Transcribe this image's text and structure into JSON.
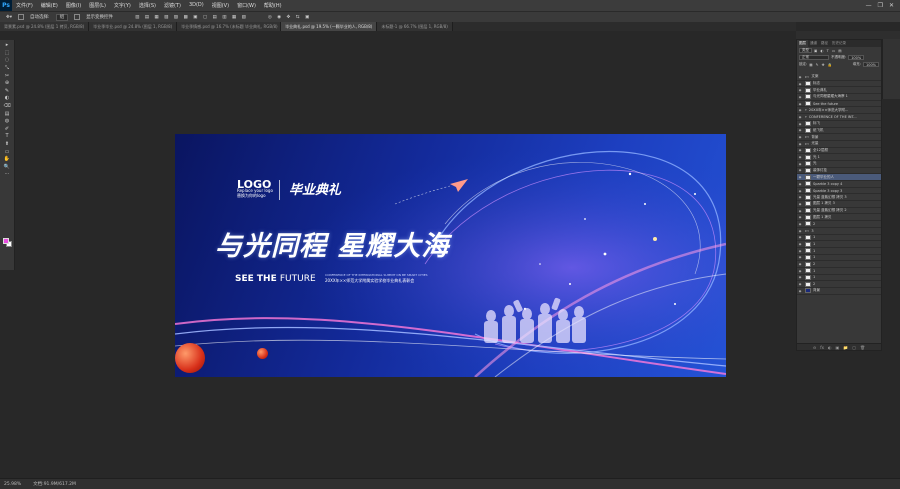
{
  "app": {
    "logo": "Ps"
  },
  "menu": [
    "文件(F)",
    "编辑(E)",
    "图像(I)",
    "图层(L)",
    "文字(Y)",
    "选择(S)",
    "滤镜(T)",
    "3D(D)",
    "视图(V)",
    "窗口(W)",
    "帮助(H)"
  ],
  "window_controls": [
    "—",
    "❐",
    "✕"
  ],
  "options_bar": {
    "auto_select_label": "自动选择:",
    "auto_select_value": "组",
    "show_transform_label": "显示变换控件"
  },
  "tabs": [
    {
      "label": "背景素.psd @ 24.8% (图层 1 拷贝, RGB/8)"
    },
    {
      "label": "毕业季毕业.psd @ 24.8% (图层 1, RGB/8)"
    },
    {
      "label": "毕业季情感.psd @ 16.7% (未标题 毕业典礼, RGB/8)"
    },
    {
      "label": "毕业典礼.psd @ 19.5% (一颗毕业的人, RGB/8)",
      "active": true
    },
    {
      "label": "未标题-1 @ 66.7% (图层 1, RGB/8)"
    }
  ],
  "tools": [
    "▸",
    "⬚",
    "◌",
    "⤡",
    "✂",
    "⊕",
    "✎",
    "◐",
    "⌫",
    "▤",
    "◍",
    "✐",
    "T",
    "⬆",
    "▭",
    "✋",
    "🔍",
    "⋯"
  ],
  "colors": {
    "foreground": "#e94ddf",
    "background": "#ffffff",
    "accent": "#31a8ff"
  },
  "canvas": {
    "logo_text": "LOGO",
    "logo_sub_1": "Replace your logo",
    "logo_sub_2": "替换为你的logo",
    "graduation": "毕业典礼",
    "headline": "与光同程  星耀大海",
    "see_bold": "SEE THE",
    "see_thin": "FUTURE",
    "see_small": "CONFERENCE OF THE INTERNATIONAL SUMMIT ON BE SMART CITIES",
    "see_small_2": "20XX年××师范大学附属实验学校毕业典礼表彰会"
  },
  "panel": {
    "tabs": [
      "图层",
      "通道",
      "路径",
      "历史记录"
    ],
    "blend_mode": "正常",
    "opacity_label": "不透明度:",
    "opacity_value": "100%",
    "lock_label": "锁定:",
    "fill_label": "填充:",
    "fill_value": "100%",
    "search_label": "类型",
    "layers": [
      {
        "name": "文案",
        "type": "folder"
      },
      {
        "name": "标志",
        "type": "layer"
      },
      {
        "name": "毕业典礼",
        "type": "layer"
      },
      {
        "name": "与光同程星耀大海摩 1",
        "type": "layer"
      },
      {
        "name": "See the future",
        "type": "layer"
      },
      {
        "name": "20XX年××师范大学附...",
        "type": "text"
      },
      {
        "name": "CONFERENCE OF THE INT...",
        "type": "text"
      },
      {
        "name": "标飞",
        "type": "layer"
      },
      {
        "name": "纸飞机",
        "type": "layer"
      },
      {
        "name": "背景",
        "type": "folder"
      },
      {
        "name": "光量",
        "type": "folder"
      },
      {
        "name": "全12层颜",
        "type": "layer"
      },
      {
        "name": "光 1",
        "type": "layer"
      },
      {
        "name": "光",
        "type": "layer"
      },
      {
        "name": "装饰灯挂",
        "type": "layer"
      },
      {
        "name": "一颗毕业的人",
        "type": "layer",
        "selected": true
      },
      {
        "name": "Sparkle 3 copy 4",
        "type": "layer"
      },
      {
        "name": "Sparkle 3 copy 3",
        "type": "layer"
      },
      {
        "name": "光量 蓝紫幻想 拷贝 3",
        "type": "layer"
      },
      {
        "name": "图层 1 拷贝 3",
        "type": "layer"
      },
      {
        "name": "光量 蓝紫幻想 拷贝 2",
        "type": "layer"
      },
      {
        "name": "图层 1 拷贝",
        "type": "layer"
      },
      {
        "name": "2",
        "type": "layer"
      },
      {
        "name": "3",
        "type": "folder"
      },
      {
        "name": "1",
        "type": "layer"
      },
      {
        "name": "1",
        "type": "layer"
      },
      {
        "name": "1",
        "type": "layer"
      },
      {
        "name": "1",
        "type": "layer"
      },
      {
        "name": "2",
        "type": "layer"
      },
      {
        "name": "1",
        "type": "layer"
      },
      {
        "name": "1",
        "type": "layer"
      },
      {
        "name": "2",
        "type": "layer"
      },
      {
        "name": "背景",
        "type": "layer",
        "dark": true
      }
    ],
    "footer_icons": [
      "⊖",
      "fx",
      "◐",
      "▣",
      "📁",
      "▢",
      "🗑"
    ]
  },
  "status": {
    "zoom": "25.98%",
    "doc": "文档:91.9M/617.2M"
  }
}
